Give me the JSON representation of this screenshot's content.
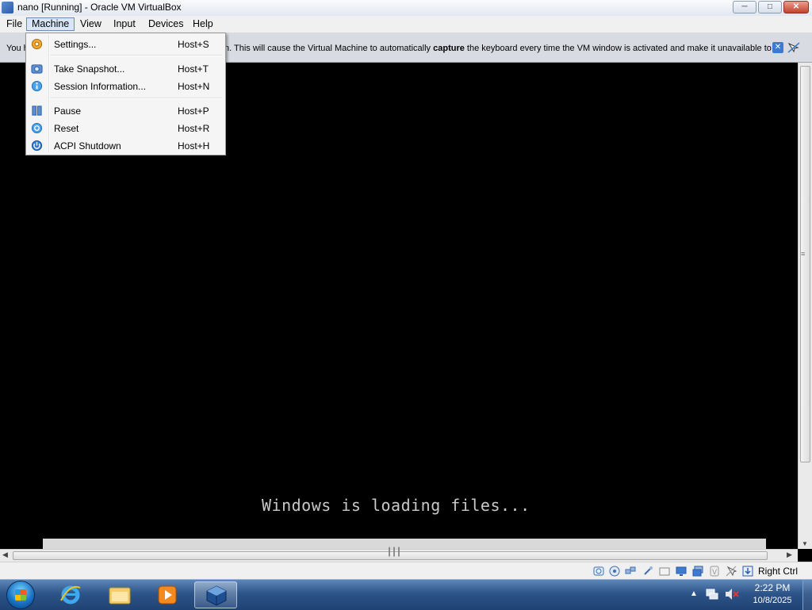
{
  "window": {
    "title": "nano [Running] - Oracle VM VirtualBox"
  },
  "menubar": {
    "items": [
      "File",
      "Machine",
      "View",
      "Input",
      "Devices",
      "Help"
    ],
    "active": "Machine"
  },
  "notice": {
    "text_left": "You h",
    "text_before_bold": "n. This will cause the Virtual Machine to automatically ",
    "bold_word": "capture",
    "text_after_bold": " the keyboard every time the VM window is activated and make it unavailable to"
  },
  "machine_menu": {
    "items": [
      {
        "label": "Settings...",
        "shortcut": "Host+S",
        "icon": "gear-icon"
      },
      {
        "label": "Take Snapshot...",
        "shortcut": "Host+T",
        "icon": "camera-icon"
      },
      {
        "label": "Session Information...",
        "shortcut": "Host+N",
        "icon": "info-icon"
      },
      {
        "label": "Pause",
        "shortcut": "Host+P",
        "icon": "pause-icon"
      },
      {
        "label": "Reset",
        "shortcut": "Host+R",
        "icon": "reset-icon"
      },
      {
        "label": "ACPI Shutdown",
        "shortcut": "Host+H",
        "icon": "power-icon"
      }
    ]
  },
  "vm_screen": {
    "message": "Windows is loading files..."
  },
  "statusbar": {
    "host_key": "Right Ctrl"
  },
  "taskbar": {
    "apps": [
      "internet-explorer",
      "windows-explorer",
      "media-player",
      "virtualbox"
    ],
    "clock_time": "2:22 PM",
    "clock_date": "10/8/2025"
  },
  "colors": {
    "taskbar": "#2c5488",
    "vm_screen": "#000000",
    "menu_highlight": "#d8e6f7"
  }
}
